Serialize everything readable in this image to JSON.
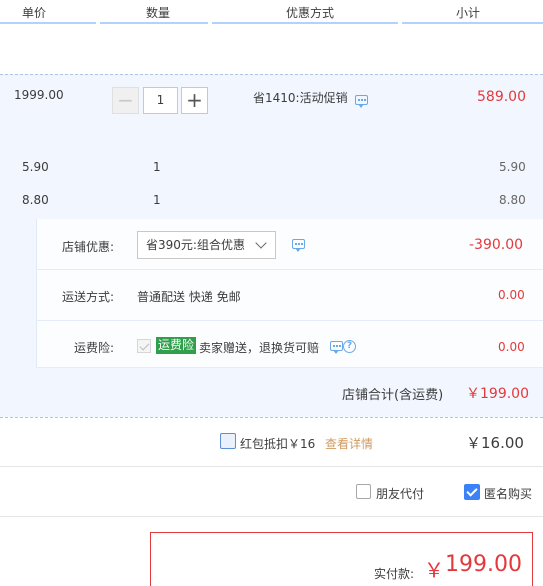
{
  "header": {
    "unit_price": "单价",
    "quantity": "数量",
    "discount": "优惠方式",
    "subtotal": "小计"
  },
  "items": [
    {
      "price": "1999.00",
      "quantity": "1",
      "promo": "省1410:活动促销",
      "subtotal": "589.00"
    },
    {
      "price": "5.90",
      "quantity": "1",
      "subtotal": "5.90"
    },
    {
      "price": "8.80",
      "quantity": "1",
      "subtotal": "8.80"
    }
  ],
  "stepper": {
    "minus": "−",
    "plus": "+"
  },
  "shop": {
    "discount_label": "店铺优惠:",
    "discount_select": "省390元:组合优惠",
    "discount_amount": "-390.00",
    "shipping_label": "运送方式:",
    "shipping_value": "普通配送 快递 免邮",
    "shipping_amount": "0.00",
    "insurance_label": "运费险:",
    "insurance_tag": "运费险",
    "insurance_desc": "卖家赠送，退换货可赔",
    "insurance_amount": "0.00",
    "total_label": "店铺合计(含运费)",
    "total_amount": "￥199.00"
  },
  "redpacket": {
    "label": "红包抵扣￥16",
    "link": "查看详情",
    "amount": "￥16.00"
  },
  "options": {
    "friend_pay": "朋友代付",
    "anonymous": "匿名购买"
  },
  "payment": {
    "label": "实付款:",
    "currency": "￥",
    "amount": "199.00"
  },
  "colors": {
    "accent_red": "#e4393c",
    "band_blue": "#f2f7ff",
    "link": "#d09a5e",
    "check_blue": "#3b82f6",
    "tag_green": "#2f9f4b"
  }
}
